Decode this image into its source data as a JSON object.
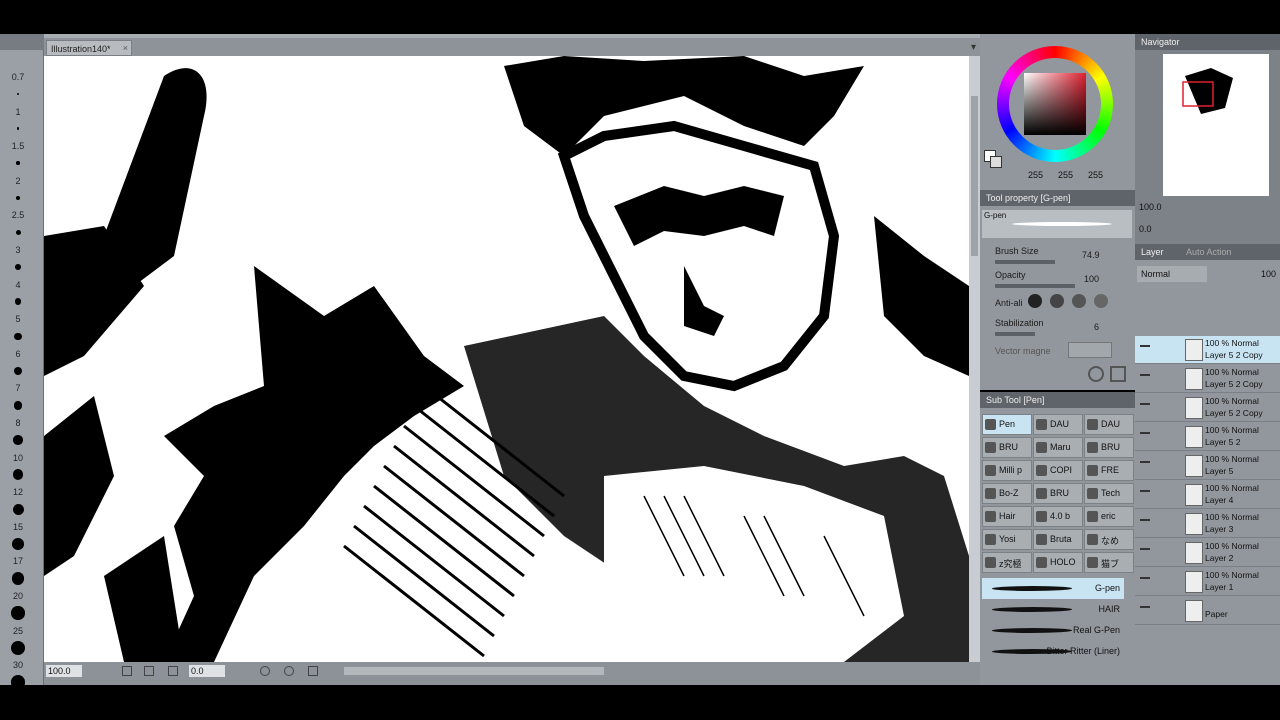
{
  "document": {
    "tab_title": "Illustration140*",
    "tab_close": "×",
    "tab_menu": "▾"
  },
  "brush_sizes": [
    "0.7",
    "1",
    "1.5",
    "2",
    "2.5",
    "3",
    "4",
    "5",
    "6",
    "7",
    "8",
    "10",
    "12",
    "15",
    "17",
    "20",
    "25",
    "30"
  ],
  "statusbar": {
    "zoom": "100.0",
    "rotation": "0.0"
  },
  "color": {
    "r": "255",
    "g": "255",
    "b": "255",
    "accent": "#e02030"
  },
  "navigator": {
    "title": "Navigator",
    "zoom": "100.0",
    "rotation": "0.0"
  },
  "tool_property": {
    "title": "Tool property [G-pen]",
    "preset": "G-pen",
    "brush_size_label": "Brush Size",
    "brush_size_value": "74.9",
    "opacity_label": "Opacity",
    "opacity_value": "100",
    "antialias_label": "Anti-ali",
    "stabilization_label": "Stabilization",
    "stabilization_value": "6",
    "vector_label": "Vector magne"
  },
  "sub_tool": {
    "title": "Sub Tool [Pen]",
    "groups": [
      [
        "Pen",
        "DAU",
        "DAU"
      ],
      [
        "BRU",
        "Maru",
        "BRU"
      ],
      [
        "Milli p",
        "COPI",
        "FRE"
      ],
      [
        "Bo-Z",
        "BRU",
        "Tech"
      ],
      [
        "Hair",
        "4.0 b",
        "eric"
      ],
      [
        "Yosi",
        "Bruta",
        "なめ"
      ],
      [
        "z究極",
        "HOLO",
        "猫ブ"
      ]
    ],
    "strokes": [
      "G-pen",
      "HAIR",
      "Real G-Pen",
      "Bitter Ritter (Liner)"
    ]
  },
  "layer_panel": {
    "title": "Layer",
    "tab2": "Auto Action",
    "blend_mode": "Normal",
    "opacity": "100",
    "layers": [
      {
        "mode": "100 % Normal",
        "name": "Layer 5 2 Copy",
        "selected": true
      },
      {
        "mode": "100 % Normal",
        "name": "Layer 5 2 Copy",
        "selected": false
      },
      {
        "mode": "100 % Normal",
        "name": "Layer 5 2 Copy",
        "selected": false
      },
      {
        "mode": "100 % Normal",
        "name": "Layer 5 2",
        "selected": false
      },
      {
        "mode": "100 % Normal",
        "name": "Layer 5",
        "selected": false
      },
      {
        "mode": "100 % Normal",
        "name": "Layer 4",
        "selected": false
      },
      {
        "mode": "100 % Normal",
        "name": "Layer 3",
        "selected": false
      },
      {
        "mode": "100 % Normal",
        "name": "Layer 2",
        "selected": false
      },
      {
        "mode": "100 % Normal",
        "name": "Layer 1",
        "selected": false
      },
      {
        "mode": "",
        "name": "Paper",
        "selected": false
      }
    ]
  }
}
